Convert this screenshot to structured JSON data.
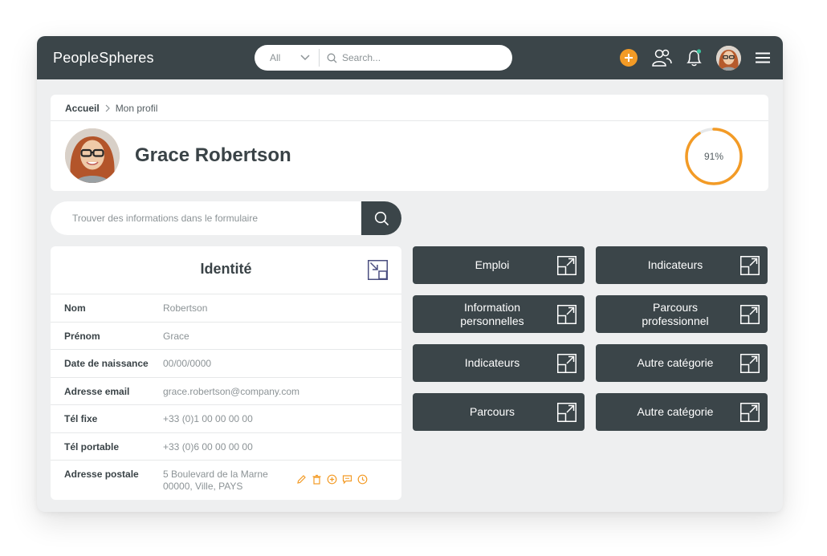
{
  "app": {
    "logo_light": "People",
    "logo_bold": "Spheres"
  },
  "topbar": {
    "search_filter": "All",
    "search_placeholder": "Search...",
    "icons": [
      "add-icon",
      "users-icon",
      "bell-icon",
      "avatar",
      "menu-icon"
    ],
    "accent_color": "#f39b26",
    "bar_color": "#3b4549"
  },
  "breadcrumb": {
    "home": "Accueil",
    "current": "Mon profil"
  },
  "profile": {
    "name": "Grace Robertson",
    "completion_label": "91%",
    "completion_value": 0.91
  },
  "form_search": {
    "placeholder": "Trouver des informations dans le formulaire"
  },
  "identity": {
    "title": "Identité",
    "rows": [
      {
        "label": "Nom",
        "value": "Robertson"
      },
      {
        "label": "Prénom",
        "value": "Grace"
      },
      {
        "label": "Date de naissance",
        "value": "00/00/0000"
      },
      {
        "label": "Adresse email",
        "value": "grace.robertson@company.com"
      },
      {
        "label": "Tél fixe",
        "value": "+33 (0)1 00 00 00 00"
      },
      {
        "label": "Tél portable",
        "value": "+33 (0)6 00 00 00 00"
      },
      {
        "label": "Adresse postale",
        "value_line1": "5 Boulevard de la Marne",
        "value_line2": "00000, Ville, PAYS"
      }
    ],
    "row_actions": [
      "edit-icon",
      "trash-icon",
      "add-circle-icon",
      "comment-icon",
      "clock-icon"
    ]
  },
  "categories": [
    {
      "line1": "Emploi",
      "line2": ""
    },
    {
      "line1": "Indicateurs",
      "line2": ""
    },
    {
      "line1": "Information",
      "line2": "personnelles"
    },
    {
      "line1": "Parcours",
      "line2": "professionnel"
    },
    {
      "line1": "Indicateurs",
      "line2": ""
    },
    {
      "line1": "Autre catégorie",
      "line2": ""
    },
    {
      "line1": "Parcours",
      "line2": ""
    },
    {
      "line1": "Autre catégorie",
      "line2": ""
    }
  ]
}
